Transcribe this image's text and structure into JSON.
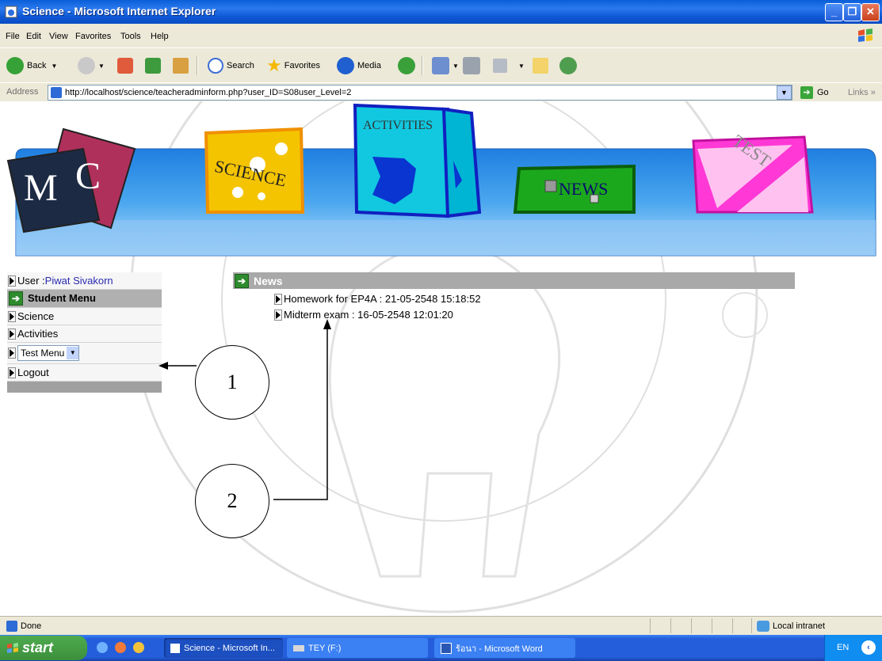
{
  "window": {
    "title": "Science - Microsoft Internet Explorer"
  },
  "menubar": {
    "items": [
      "File",
      "Edit",
      "View",
      "Favorites",
      "Tools",
      "Help"
    ]
  },
  "toolbar": {
    "back": "Back",
    "search": "Search",
    "favorites": "Favorites",
    "media": "Media"
  },
  "address": {
    "label": "Address",
    "url": "http://localhost/science/teacheradminform.php?user_ID=S08user_Level=2",
    "go": "Go",
    "links": "Links"
  },
  "banner": {
    "logo": "MC",
    "science": "SCIENCE",
    "activities": "ACTIVITIES",
    "news": "NEWS",
    "test": "TEST"
  },
  "sidebar": {
    "user_label": "User : ",
    "user_name": "Piwat Sivakorn",
    "student_menu": "Student Menu",
    "science": "Science",
    "activities": "Activities",
    "test_menu": "Test Menu",
    "logout": "Logout"
  },
  "news": {
    "header": "News",
    "items": [
      "Homework for EP4A : 21-05-2548 15:18:52",
      "Midterm exam : 16-05-2548 12:01:20"
    ]
  },
  "annotations": {
    "one": "1",
    "two": "2"
  },
  "statusbar": {
    "status": "Done",
    "zone": "Local intranet"
  },
  "taskbar": {
    "start": "start",
    "tasks": [
      "Science - Microsoft In...",
      "TEY (F:)",
      "ร้อนา - Microsoft Word"
    ],
    "lang": "EN"
  },
  "colors": {
    "titlebar": "#0a5fd8",
    "banner_blue": "#3d9de8",
    "menu_gray": "#b0b0b0",
    "link_blue": "#2a2ab0"
  }
}
